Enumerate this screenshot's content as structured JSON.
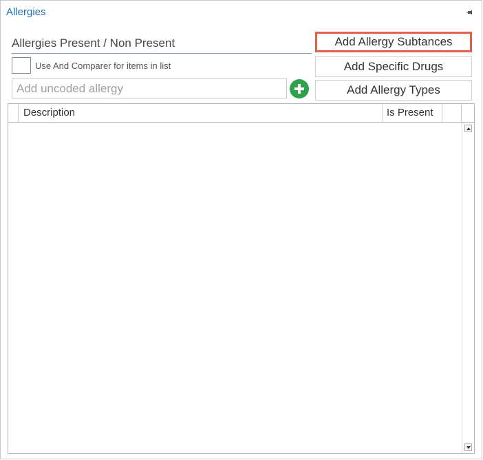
{
  "panel": {
    "title": "Allergies",
    "pin_icon": "pin-icon"
  },
  "section": {
    "label": "Allergies Present / Non Present"
  },
  "options": {
    "and_comparer_label": "Use And Comparer for items in list",
    "and_comparer_checked": false
  },
  "uncoded": {
    "placeholder": "Add uncoded allergy",
    "value": "",
    "add_icon": "plus-circle-icon"
  },
  "buttons": {
    "add_substances": "Add Allergy Subtances",
    "add_drugs": "Add Specific Drugs",
    "add_types": "Add Allergy Types"
  },
  "grid": {
    "columns": [
      "Description",
      "Is Present"
    ],
    "rows": []
  },
  "colors": {
    "title_blue": "#1e6fb5",
    "highlight_border": "#e0614c",
    "add_green": "#2ea14b"
  }
}
